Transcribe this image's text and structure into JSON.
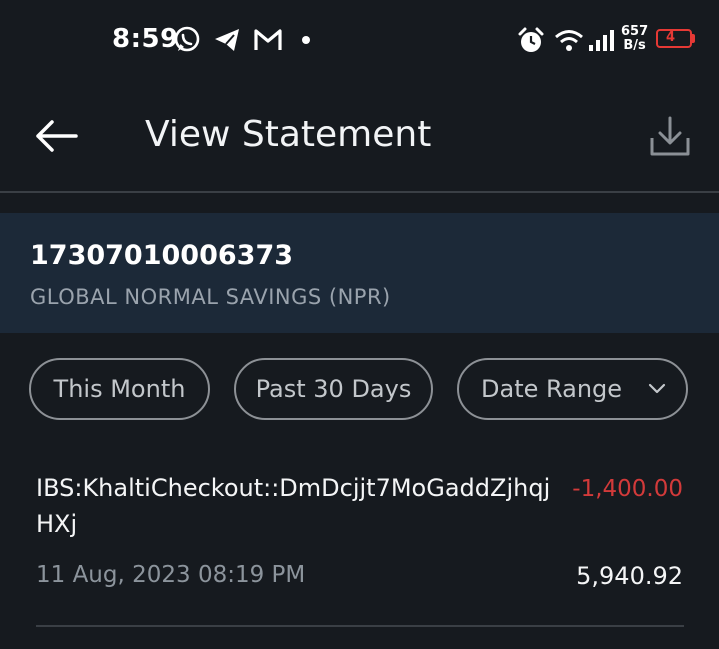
{
  "status_bar": {
    "time": "8:59",
    "net_speed_value": "657",
    "net_speed_unit": "B/s",
    "battery_level": "4"
  },
  "header": {
    "title": "View Statement"
  },
  "account": {
    "number": "17307010006373",
    "name": "GLOBAL NORMAL SAVINGS (NPR)"
  },
  "filters": {
    "this_month": "This Month",
    "past_30_days": "Past 30 Days",
    "date_range": "Date Range"
  },
  "transactions": [
    {
      "description": "IBS:KhaltiCheckout::DmDcjjt7MoGaddZjhqjHXj",
      "amount": "-1,400.00",
      "date": "11 Aug, 2023 08:19 PM",
      "balance": "5,940.92"
    }
  ],
  "colors": {
    "background": "#161a1f",
    "card": "#1c2938",
    "debit": "#d23a3a",
    "battery_low": "#e53935"
  }
}
